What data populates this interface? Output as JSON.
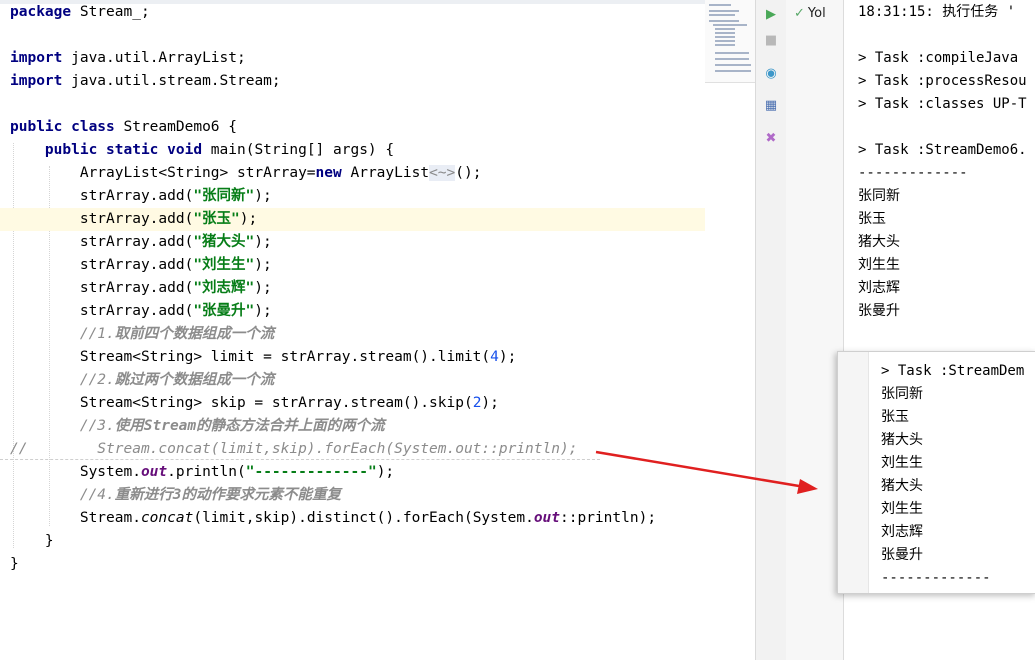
{
  "editor": {
    "lines": [
      [
        {
          "t": "package",
          "c": "kw"
        },
        {
          "t": " Stream_;",
          "c": "txt"
        }
      ],
      [],
      [
        {
          "t": "import",
          "c": "kw"
        },
        {
          "t": " java.util.ArrayList;",
          "c": "txt"
        }
      ],
      [
        {
          "t": "import",
          "c": "kw"
        },
        {
          "t": " java.util.stream.Stream;",
          "c": "txt"
        }
      ],
      [],
      [
        {
          "t": "public class",
          "c": "kw"
        },
        {
          "t": " StreamDemo6 {",
          "c": "txt"
        }
      ],
      [
        {
          "t": "    ",
          "c": "txt"
        },
        {
          "t": "public static void",
          "c": "kw"
        },
        {
          "t": " main(String[] args) {",
          "c": "txt"
        }
      ],
      [
        {
          "t": "        ArrayList<String> strArray=",
          "c": "txt"
        },
        {
          "t": "new",
          "c": "kw"
        },
        {
          "t": " ArrayList",
          "c": "txt"
        },
        {
          "t": "<~>",
          "c": "fold"
        },
        {
          "t": "();",
          "c": "txt"
        }
      ],
      [
        {
          "t": "        strArray.add(",
          "c": "txt"
        },
        {
          "t": "\"张同新\"",
          "c": "str"
        },
        {
          "t": ");",
          "c": "txt"
        }
      ],
      [
        {
          "t": "        strArray.add(",
          "c": "txt"
        },
        {
          "t": "\"张玉\"",
          "c": "str"
        },
        {
          "t": ");",
          "c": "txt"
        }
      ],
      [
        {
          "t": "        strArray.add(",
          "c": "txt"
        },
        {
          "t": "\"猪大头\"",
          "c": "str"
        },
        {
          "t": ");",
          "c": "txt"
        }
      ],
      [
        {
          "t": "        strArray.add(",
          "c": "txt"
        },
        {
          "t": "\"刘生生\"",
          "c": "str"
        },
        {
          "t": ");",
          "c": "txt"
        }
      ],
      [
        {
          "t": "        strArray.add(",
          "c": "txt"
        },
        {
          "t": "\"刘志辉\"",
          "c": "str"
        },
        {
          "t": ");",
          "c": "txt"
        }
      ],
      [
        {
          "t": "        strArray.add(",
          "c": "txt"
        },
        {
          "t": "\"张曼升\"",
          "c": "str"
        },
        {
          "t": ");",
          "c": "txt"
        }
      ],
      [
        {
          "t": "        //1.",
          "c": "cm"
        },
        {
          "t": "取前四个数据组成一个流",
          "c": "cmb"
        }
      ],
      [
        {
          "t": "        Stream<String> limit = strArray.stream().limit(",
          "c": "txt"
        },
        {
          "t": "4",
          "c": "num"
        },
        {
          "t": ");",
          "c": "txt"
        }
      ],
      [
        {
          "t": "        //2.",
          "c": "cm"
        },
        {
          "t": "跳过两个数据组成一个流",
          "c": "cmb"
        }
      ],
      [
        {
          "t": "        Stream<String> skip = strArray.stream().skip(",
          "c": "txt"
        },
        {
          "t": "2",
          "c": "num"
        },
        {
          "t": ");",
          "c": "txt"
        }
      ],
      [
        {
          "t": "        //3.",
          "c": "cm"
        },
        {
          "t": "使用Stream的静态方法合并上面的两个流",
          "c": "cmb"
        }
      ],
      [
        {
          "t": "//        Stream.concat(limit,skip).forEach(System.out::println);",
          "c": "cm"
        }
      ],
      [
        {
          "t": "        System.",
          "c": "txt"
        },
        {
          "t": "out",
          "c": "fld"
        },
        {
          "t": ".println(",
          "c": "txt"
        },
        {
          "t": "\"-------------\"",
          "c": "str"
        },
        {
          "t": ");",
          "c": "txt"
        }
      ],
      [
        {
          "t": "        //4.",
          "c": "cm"
        },
        {
          "t": "重新进行3的动作要求元素不能重复",
          "c": "cmb"
        }
      ],
      [
        {
          "t": "        Stream.",
          "c": "txt"
        },
        {
          "t": "concat",
          "c": "it"
        },
        {
          "t": "(limit,skip).distinct().forEach(System.",
          "c": "txt"
        },
        {
          "t": "out",
          "c": "fld"
        },
        {
          "t": "::println);",
          "c": "txt"
        }
      ],
      [
        {
          "t": "    }",
          "c": "txt"
        }
      ],
      [
        {
          "t": "}",
          "c": "txt"
        }
      ]
    ],
    "highlighted_line": 9
  },
  "run_tree": {
    "item_label": "Yol"
  },
  "console": {
    "lines": [
      "18:31:15: 执行任务 '",
      "",
      "> Task :compileJava",
      "> Task :processResou",
      "> Task :classes UP-T",
      "",
      "> Task :StreamDemo6.",
      "-------------",
      "张同新",
      "张玉",
      "猪大头",
      "刘生生",
      "刘志辉",
      "张曼升"
    ]
  },
  "popup": {
    "lines": [
      "> Task :StreamDem",
      "张同新",
      "张玉",
      "猪大头",
      "刘生生",
      "猪大头",
      "刘生生",
      "刘志辉",
      "张曼升",
      "-------------"
    ]
  },
  "colors": {
    "arrow": "#e02020",
    "keyword": "#000080",
    "string": "#067d17",
    "comment": "#8c8c8c",
    "highlight": "#fffae3"
  },
  "icons": {
    "run": "run-icon",
    "stop": "stop-icon",
    "eye": "eye-icon",
    "layout": "layout-icon",
    "pin": "pin-icon"
  }
}
